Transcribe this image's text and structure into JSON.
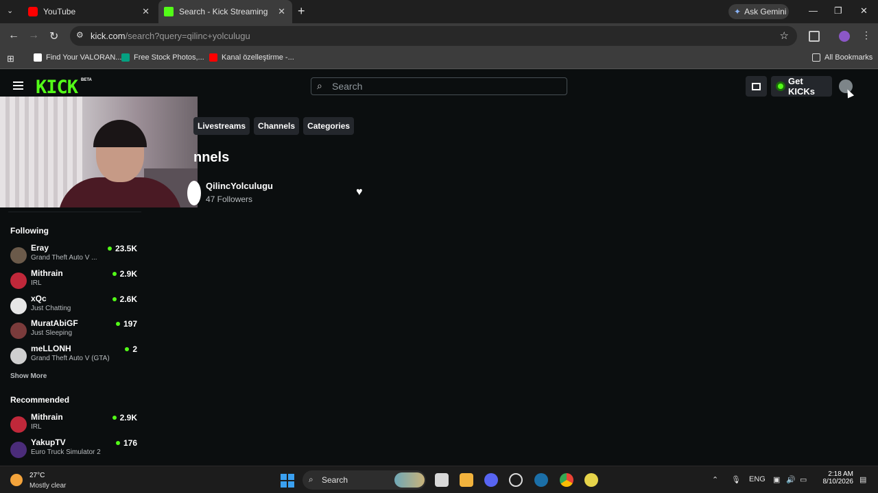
{
  "browser": {
    "tabs": [
      {
        "title": "YouTube",
        "icon": "youtube-icon"
      },
      {
        "title": "Search - Kick Streaming",
        "icon": "kick-icon"
      }
    ],
    "gemini_label": "Ask Gemini",
    "url_host": "kick.com",
    "url_path": "/search?query=qilinc+yolculugu",
    "bookmarks": [
      {
        "label": "Find Your VALORAN...",
        "color": "#ffffff"
      },
      {
        "label": "Free Stock Photos,...",
        "color": "#05a081"
      },
      {
        "label": "Kanal özelleştirme -...",
        "color": "#ff0000"
      }
    ],
    "all_bookmarks": "All Bookmarks"
  },
  "kick": {
    "logo": "KICK",
    "beta": "BETA",
    "search_placeholder": "Search",
    "get_kicks": "Get KICKs",
    "accent": "#53fc18",
    "filters": [
      "Livestreams",
      "Channels",
      "Categories"
    ],
    "section_title": "nnels",
    "result": {
      "name": "QilincYolculugu",
      "followers": "47 Followers"
    },
    "following_title": "Following",
    "following": [
      {
        "name": "Eray",
        "game": "Grand Theft Auto V ...",
        "viewers": "23.5K",
        "avatar": "#6b5a4a"
      },
      {
        "name": "Mithrain",
        "game": "IRL",
        "viewers": "2.9K",
        "avatar": "#c0283a"
      },
      {
        "name": "xQc",
        "game": "Just Chatting",
        "viewers": "2.6K",
        "avatar": "#e6e6e6"
      },
      {
        "name": "MuratAbiGF",
        "game": "Just Sleeping",
        "viewers": "197",
        "avatar": "#7a3b3b"
      },
      {
        "name": "meLLONH",
        "game": "Grand Theft Auto V (GTA)",
        "viewers": "2",
        "avatar": "#cfcfcf"
      }
    ],
    "show_more": "Show More",
    "recommended_title": "Recommended",
    "recommended": [
      {
        "name": "Mithrain",
        "game": "IRL",
        "viewers": "2.9K",
        "avatar": "#c0283a"
      },
      {
        "name": "YakupTV",
        "game": "Euro Truck Simulator 2",
        "viewers": "176",
        "avatar": "#4b2c7a"
      }
    ]
  },
  "taskbar": {
    "temp": "27°C",
    "weather": "Mostly clear",
    "search": "Search",
    "lang": "ENG",
    "time": "2:18 AM",
    "date": "8/10/2026"
  }
}
